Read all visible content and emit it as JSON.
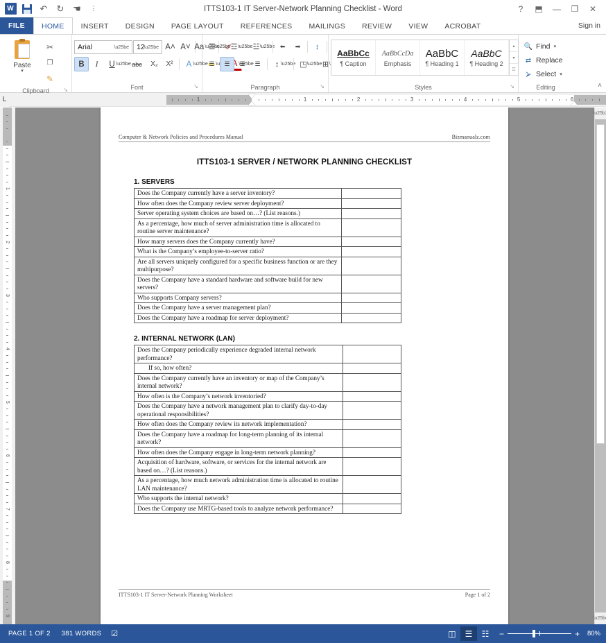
{
  "window": {
    "title": "ITTS103-1 IT Server-Network Planning Checklist - Word",
    "quick_access": [
      {
        "name": "word-logo",
        "label": "W"
      },
      {
        "name": "save-icon",
        "label": ""
      },
      {
        "name": "undo-icon",
        "label": "↶"
      },
      {
        "name": "redo-icon",
        "label": "↻"
      },
      {
        "name": "touch-mode-icon",
        "label": "☚"
      },
      {
        "name": "customize-qat-icon",
        "label": "⋮"
      }
    ],
    "controls": [
      {
        "name": "help-button",
        "label": "?"
      },
      {
        "name": "ribbon-display-options-button",
        "label": "⬒"
      },
      {
        "name": "minimize-button",
        "label": "—"
      },
      {
        "name": "maximize-button",
        "label": "❐"
      },
      {
        "name": "close-button",
        "label": "✕"
      }
    ]
  },
  "tabs": {
    "file": "FILE",
    "items": [
      "HOME",
      "INSERT",
      "DESIGN",
      "PAGE LAYOUT",
      "REFERENCES",
      "MAILINGS",
      "REVIEW",
      "VIEW",
      "ACROBAT"
    ],
    "active": "HOME",
    "sign_in": "Sign in"
  },
  "ribbon": {
    "clipboard": {
      "label": "Clipboard",
      "paste": "Paste",
      "paste_caret": "▾",
      "dialog_launcher": "↘",
      "buttons": [
        {
          "name": "cut-icon",
          "label": "✂"
        },
        {
          "name": "copy-icon",
          "label": "❐"
        },
        {
          "name": "format-painter-icon",
          "label": "✎"
        }
      ]
    },
    "font": {
      "label": "Font",
      "font_name": "Arial",
      "font_size": "12",
      "dialog_launcher": "↘",
      "row1": [
        {
          "name": "grow-font-button",
          "label": "A˄"
        },
        {
          "name": "shrink-font-button",
          "label": "A˅"
        },
        {
          "name": "change-case-button",
          "label": "Aa"
        },
        {
          "name": "clear-formatting-button",
          "label": "✐"
        }
      ],
      "row2": [
        {
          "name": "bold-button",
          "label": "B",
          "active": true
        },
        {
          "name": "italic-button",
          "label": "I",
          "active": false
        },
        {
          "name": "underline-button",
          "label": "U",
          "active": false
        },
        {
          "name": "strikethrough-button",
          "label": "abc",
          "active": false
        },
        {
          "name": "subscript-button",
          "label": "X₂",
          "active": false
        },
        {
          "name": "superscript-button",
          "label": "X²",
          "active": false
        },
        {
          "name": "text-effects-button",
          "label": "A",
          "active": false
        },
        {
          "name": "text-highlight-color-button",
          "label": "✏",
          "active": false
        },
        {
          "name": "font-color-button",
          "label": "A",
          "active": false
        }
      ]
    },
    "paragraph": {
      "label": "Paragraph",
      "dialog_launcher": "↘",
      "row1": [
        {
          "name": "bullets-button",
          "label": "☰"
        },
        {
          "name": "numbering-button",
          "label": "☲"
        },
        {
          "name": "multilevel-list-button",
          "label": "☳"
        },
        {
          "name": "decrease-indent-button",
          "label": "⬅"
        },
        {
          "name": "increase-indent-button",
          "label": "➡"
        },
        {
          "name": "sort-button",
          "label": "↕"
        },
        {
          "name": "show-formatting-marks-button",
          "label": "¶"
        }
      ],
      "row2": [
        {
          "name": "align-left-button",
          "label": "☰",
          "active": false
        },
        {
          "name": "align-center-button",
          "label": "☰",
          "active": true
        },
        {
          "name": "align-right-button",
          "label": "☰",
          "active": false
        },
        {
          "name": "justify-button",
          "label": "☰",
          "active": false
        },
        {
          "name": "line-spacing-button",
          "label": "↕",
          "active": false
        },
        {
          "name": "shading-button",
          "label": "◳",
          "active": false
        },
        {
          "name": "borders-button",
          "label": "⊞",
          "active": false
        }
      ]
    },
    "styles": {
      "label": "Styles",
      "dialog_launcher": "↘",
      "items": [
        {
          "preview": "AaBbCc",
          "name": "¶ Caption",
          "variant": "caption"
        },
        {
          "preview": "AaBbCcDa",
          "name": "Emphasis",
          "variant": "emph"
        },
        {
          "preview": "AaBbC",
          "name": "¶ Heading 1",
          "variant": "h1"
        },
        {
          "preview": "AaBbC",
          "name": "¶ Heading 2",
          "variant": "h2"
        }
      ],
      "scroll": [
        "▴",
        "▾",
        "☷"
      ]
    },
    "editing": {
      "label": "Editing",
      "items": [
        {
          "name": "find-button",
          "label": "Find",
          "icon": "🔍",
          "caret": "▾"
        },
        {
          "name": "replace-button",
          "label": "Replace",
          "icon": "⇄",
          "caret": ""
        },
        {
          "name": "select-button",
          "label": "Select",
          "icon": "⮚",
          "caret": "▾"
        }
      ]
    },
    "collapse_icon": "˄"
  },
  "ruler": {
    "tab_selector": "L",
    "h_numbers": [
      "1",
      "1",
      "2",
      "3",
      "4",
      "5"
    ],
    "v_numbers": [
      "1",
      "2",
      "3",
      "4",
      "5",
      "6",
      "7",
      "8"
    ]
  },
  "document": {
    "header_left": "Computer & Network Policies and Procedures Manual",
    "header_right": "Bizmanualz.com",
    "title": "ITTS103-1   SERVER / NETWORK PLANNING CHECKLIST",
    "sections": [
      {
        "heading": "1. SERVERS",
        "rows": [
          {
            "q": "Does the Company currently have a server inventory?",
            "indent": false
          },
          {
            "q": "How often does the Company review server deployment?",
            "indent": false
          },
          {
            "q": "Server operating system choices are based on…?  (List reasons.)",
            "indent": false
          },
          {
            "q": "As a percentage, how much of server administration time is allocated to routine server maintenance?",
            "indent": false
          },
          {
            "q": "How many servers does the Company currently have?",
            "indent": false
          },
          {
            "q": "What is the Company’s employee-to-server ratio?",
            "indent": false
          },
          {
            "q": "Are all servers uniquely configured for a specific business function or are they multipurpose?",
            "indent": false
          },
          {
            "q": "Does the Company have a standard hardware and software build for new servers?",
            "indent": false
          },
          {
            "q": "Who supports Company servers?",
            "indent": false
          },
          {
            "q": "Does the Company have a server management plan?",
            "indent": false
          },
          {
            "q": "Does the Company have a roadmap for server deployment?",
            "indent": false
          }
        ]
      },
      {
        "heading": "2. INTERNAL NETWORK (LAN)",
        "rows": [
          {
            "q": "Does the Company periodically experience degraded internal network performance?",
            "indent": false
          },
          {
            "q": "If so, how often?",
            "indent": true
          },
          {
            "q": "Does the Company currently have an inventory or map of the Company’s internal network?",
            "indent": false
          },
          {
            "q": "How often is the Company’s network inventoried?",
            "indent": false
          },
          {
            "q": "Does the Company have a network management plan to clarify day-to-day operational responsibilities?",
            "indent": false
          },
          {
            "q": "How often does the Company review its network implementation?",
            "indent": false
          },
          {
            "q": "Does the Company have a roadmap for long-term planning of its internal network?",
            "indent": false
          },
          {
            "q": "How often does the Company engage in long-term network planning?",
            "indent": false
          },
          {
            "q": "Acquisition of hardware, software, or services for the internal network are based on…?  (List reasons.)",
            "indent": false
          },
          {
            "q": "As a percentage, how much network administration time is allocated to routine LAN maintenance?",
            "indent": false
          },
          {
            "q": "Who supports the internal network?",
            "indent": false
          },
          {
            "q": "Does the Company use MRTG-based tools to analyze network performance?",
            "indent": false
          }
        ]
      }
    ],
    "footer_left": "ITTS103-1 IT Server-Network Planning Worksheet",
    "footer_right": "Page 1 of 2"
  },
  "status_bar": {
    "page": "PAGE 1 OF 2",
    "words": "381 WORDS",
    "proofing_icon": "☑",
    "views": [
      {
        "name": "read-mode-button",
        "label": "◫",
        "active": false
      },
      {
        "name": "print-layout-button",
        "label": "☰",
        "active": true
      },
      {
        "name": "web-layout-button",
        "label": "☷",
        "active": false
      }
    ],
    "zoom_out": "−",
    "zoom_in": "+",
    "zoom_level": "80%"
  }
}
